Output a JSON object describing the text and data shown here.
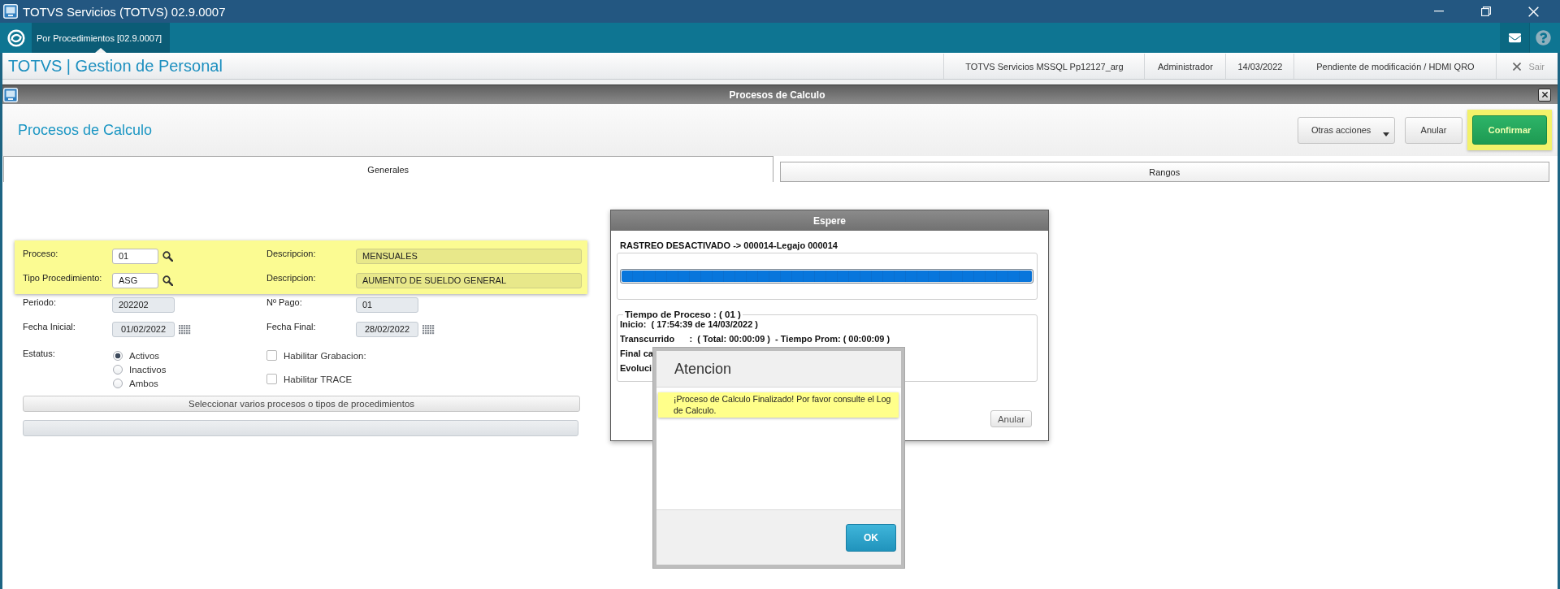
{
  "app_window": {
    "title": "TOTVS Servicios (TOTVS) 02.9.0007"
  },
  "tab_bar": {
    "tabs": [
      {
        "label": "Por Procedimientos [02.9.0007]",
        "selected": true
      }
    ]
  },
  "header": {
    "title": "TOTVS | Gestion de Personal",
    "info": [
      "TOTVS Servicios MSSQL Pp12127_arg",
      "Administrador",
      "14/03/2022",
      "Pendiente de modificación / HDMI QRO"
    ],
    "logout": "Sair"
  },
  "dialog": {
    "title": "Procesos de Calculo",
    "heading": "Procesos de Calculo",
    "actions": [
      {
        "label": "Otras acciones",
        "kind": "menu",
        "highlighted": false
      },
      {
        "label": "Anular",
        "kind": "plain",
        "highlighted": false
      },
      {
        "label": "Confirmar",
        "kind": "primary",
        "highlighted": true
      }
    ],
    "tabs": [
      {
        "label": "Generales",
        "selected": true
      },
      {
        "label": "Rangos",
        "selected": false
      }
    ]
  },
  "form": {
    "sections": [
      {
        "highlighted": true,
        "rows": [
          [
            {
              "label": "Proceso:",
              "value": "01",
              "kind": "lookup",
              "disabled": false
            },
            {
              "label": "Descripcion:",
              "value": "MENSUALES",
              "kind": "description",
              "disabled": true
            }
          ],
          [
            {
              "label": "Tipo Procedimiento:",
              "value": "ASG",
              "kind": "lookup",
              "disabled": false
            },
            {
              "label": "Descripcion:",
              "value": "AUMENTO DE SUELDO GENERAL",
              "kind": "description",
              "disabled": true
            }
          ]
        ]
      },
      {
        "highlighted": false,
        "rows": [
          [
            {
              "label": "Periodo:",
              "value": "202202",
              "kind": "code",
              "disabled": true
            },
            {
              "label": "Nº Pago:",
              "value": "01",
              "kind": "code",
              "disabled": true
            }
          ],
          [
            {
              "label": "Fecha Inicial:",
              "value": "01/02/2022",
              "kind": "date",
              "disabled": true
            },
            {
              "label": "Fecha Final:",
              "value": "28/02/2022",
              "kind": "date",
              "disabled": true
            }
          ]
        ]
      }
    ],
    "status": {
      "label": "Estatus:",
      "options": [
        {
          "label": "Activos",
          "selected": true
        },
        {
          "label": "Inactivos",
          "selected": false
        },
        {
          "label": "Ambos",
          "selected": false
        }
      ]
    },
    "checkboxes": [
      {
        "label": "Habilitar Grabacion:",
        "checked": false
      },
      {
        "label": "Habilitar TRACE",
        "checked": false
      }
    ],
    "select_button": "Seleccionar varios procesos o tipos de procedimientos"
  },
  "progress_dialog": {
    "title": "Espere",
    "status": "RASTREO DESACTIVADO -> 000014-Legajo 000014",
    "level": 1,
    "group_title": "Tiempo de Proceso : ( 01 )",
    "lines": [
      "Inicio:  ( 17:54:39 de 14/03/2022 )",
      "Transcurrido      :  ( Total: 00:00:09 )  - Tiempo Prom: ( 00:00:09 )",
      "Final ca",
      "Evoluci"
    ],
    "button": "Anular"
  },
  "alert_dialog": {
    "title": "Atencion",
    "message": "¡Proceso de Calculo Finalizado! Por favor consulte el Log de Calculo.",
    "button": "OK"
  }
}
